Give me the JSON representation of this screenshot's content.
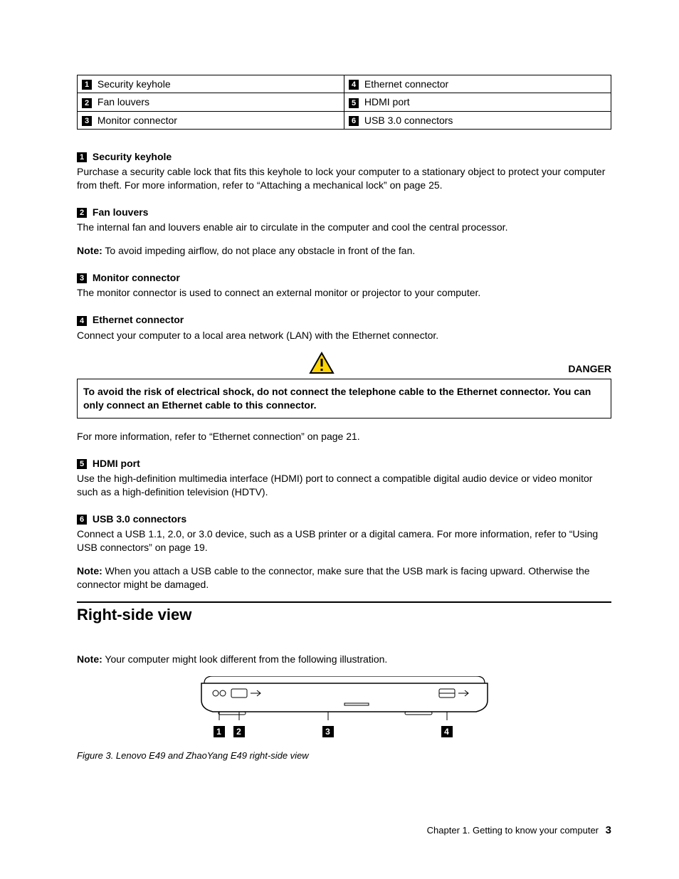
{
  "legend": {
    "r1c1": "Security keyhole",
    "r1c2": "Ethernet connector",
    "r2c1": "Fan louvers",
    "r2c2": "HDMI port",
    "r3c1": "Monitor connector",
    "r3c2": "USB 3.0 connectors",
    "n1": "1",
    "n2": "2",
    "n3": "3",
    "n4": "4",
    "n5": "5",
    "n6": "6"
  },
  "sec1": {
    "n": "1",
    "title": "Security keyhole",
    "body": "Purchase a security cable lock that fits this keyhole to lock your computer to a stationary object to protect your computer from theft. For more information, refer to “Attaching a mechanical lock” on page 25."
  },
  "sec2": {
    "n": "2",
    "title": "Fan louvers",
    "body": "The internal fan and louvers enable air to circulate in the computer and cool the central processor.",
    "note_label": "Note:",
    "note": " To avoid impeding airflow, do not place any obstacle in front of the fan."
  },
  "sec3": {
    "n": "3",
    "title": "Monitor connector",
    "body": "The monitor connector is used to connect an external monitor or projector to your computer."
  },
  "sec4": {
    "n": "4",
    "title": "Ethernet connector",
    "body": "Connect your computer to a local area network (LAN) with the Ethernet connector."
  },
  "danger": {
    "label": "DANGER",
    "text": "To avoid the risk of electrical shock, do not connect the telephone cable to the Ethernet connector. You can only connect an Ethernet cable to this connector."
  },
  "sec4b": "For more information, refer to “Ethernet connection” on page 21.",
  "sec5": {
    "n": "5",
    "title": "HDMI port",
    "body": "Use the high-definition multimedia interface (HDMI) port to connect a compatible digital audio device or video monitor such as a high-definition television (HDTV)."
  },
  "sec6": {
    "n": "6",
    "title": "USB 3.0 connectors",
    "body": "Connect a USB 1.1, 2.0, or 3.0 device, such as a USB printer or a digital camera. For more information, refer to “Using USB connectors” on page 19.",
    "note_label": "Note:",
    "note": " When you attach a USB cable to the connector, make sure that the USB mark is facing upward. Otherwise the connector might be damaged."
  },
  "rightside": {
    "heading": "Right-side view",
    "note_label": "Note:",
    "note": " Your computer might look different from the following illustration.",
    "callouts": {
      "c1": "1",
      "c2": "2",
      "c3": "3",
      "c4": "4"
    },
    "caption": "Figure 3.  Lenovo E49 and ZhaoYang E49 right-side view"
  },
  "footer": {
    "text": "Chapter 1.  Getting to know your computer",
    "page": "3"
  }
}
